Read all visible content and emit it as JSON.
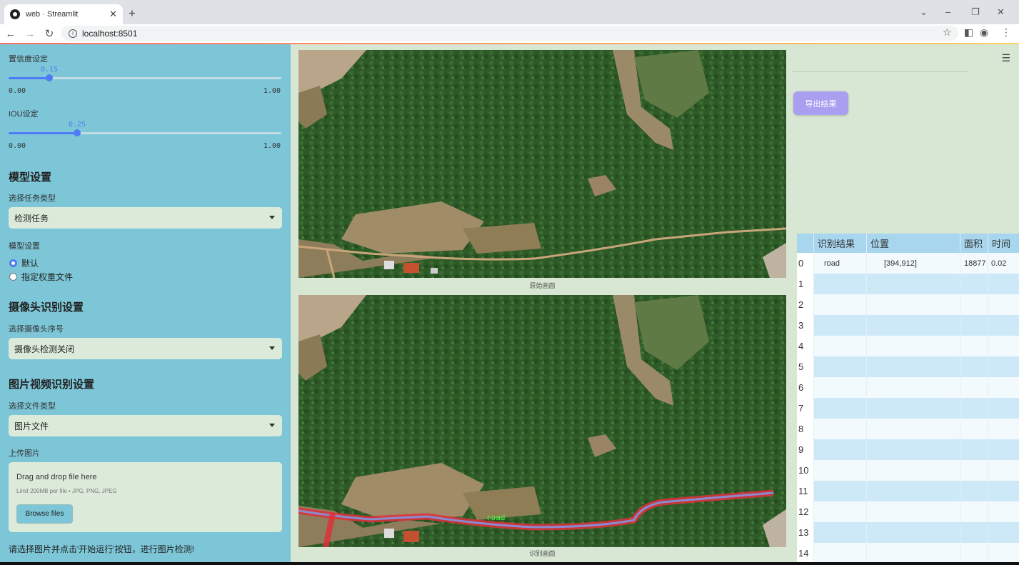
{
  "browser": {
    "tab_title": "web · Streamlit",
    "tab_close": "✕",
    "new_tab": "+",
    "url": "localhost:8501"
  },
  "sidebar": {
    "confidence": {
      "label": "置信度设定",
      "value": "0.15",
      "min": "0.00",
      "max": "1.00",
      "fraction": 0.15
    },
    "iou": {
      "label": "IOU设定",
      "value": "0.25",
      "min": "0.00",
      "max": "1.00",
      "fraction": 0.25
    },
    "model_section": "模型设置",
    "task_label": "选择任务类型",
    "task_value": "检测任务",
    "model_label": "模型设置",
    "model_options": [
      "默认",
      "指定权重文件"
    ],
    "model_selected": 0,
    "camera_section": "摄像头识别设置",
    "camera_label": "选择摄像头序号",
    "camera_value": "摄像头检测关闭",
    "media_section": "图片视频识别设置",
    "filetype_label": "选择文件类型",
    "filetype_value": "图片文件",
    "upload_label": "上传图片",
    "upload_drag": "Drag and drop file here",
    "upload_limit": "Limit 200MB per file • JPG, PNG, JPEG",
    "browse_label": "Browse files",
    "hint": "请选择图片并点击'开始运行'按钮，进行图片检测!"
  },
  "main": {
    "original_caption": "原始画面",
    "result_caption": "识别画面",
    "detection_label": "road",
    "export_label": "导出结果",
    "table": {
      "headers": [
        "",
        "识别结果",
        "位置",
        "面积",
        "时间"
      ],
      "rows": [
        [
          "0",
          "road",
          "[394,912]",
          "18877",
          "0.02"
        ],
        [
          "1",
          "",
          "",
          "",
          ""
        ],
        [
          "2",
          "",
          "",
          "",
          ""
        ],
        [
          "3",
          "",
          "",
          "",
          ""
        ],
        [
          "4",
          "",
          "",
          "",
          ""
        ],
        [
          "5",
          "",
          "",
          "",
          ""
        ],
        [
          "6",
          "",
          "",
          "",
          ""
        ],
        [
          "7",
          "",
          "",
          "",
          ""
        ],
        [
          "8",
          "",
          "",
          "",
          ""
        ],
        [
          "9",
          "",
          "",
          "",
          ""
        ],
        [
          "10",
          "",
          "",
          "",
          ""
        ],
        [
          "11",
          "",
          "",
          "",
          ""
        ],
        [
          "12",
          "",
          "",
          "",
          ""
        ],
        [
          "13",
          "",
          "",
          "",
          ""
        ],
        [
          "14",
          "",
          "",
          "",
          ""
        ]
      ]
    }
  },
  "colors": {
    "sidebar_bg": "#7cc6d8",
    "main_bg": "#d7e7d3",
    "accent": "#4f7cf5",
    "export_button": "#a99ef0",
    "detection": "#e0303a"
  }
}
